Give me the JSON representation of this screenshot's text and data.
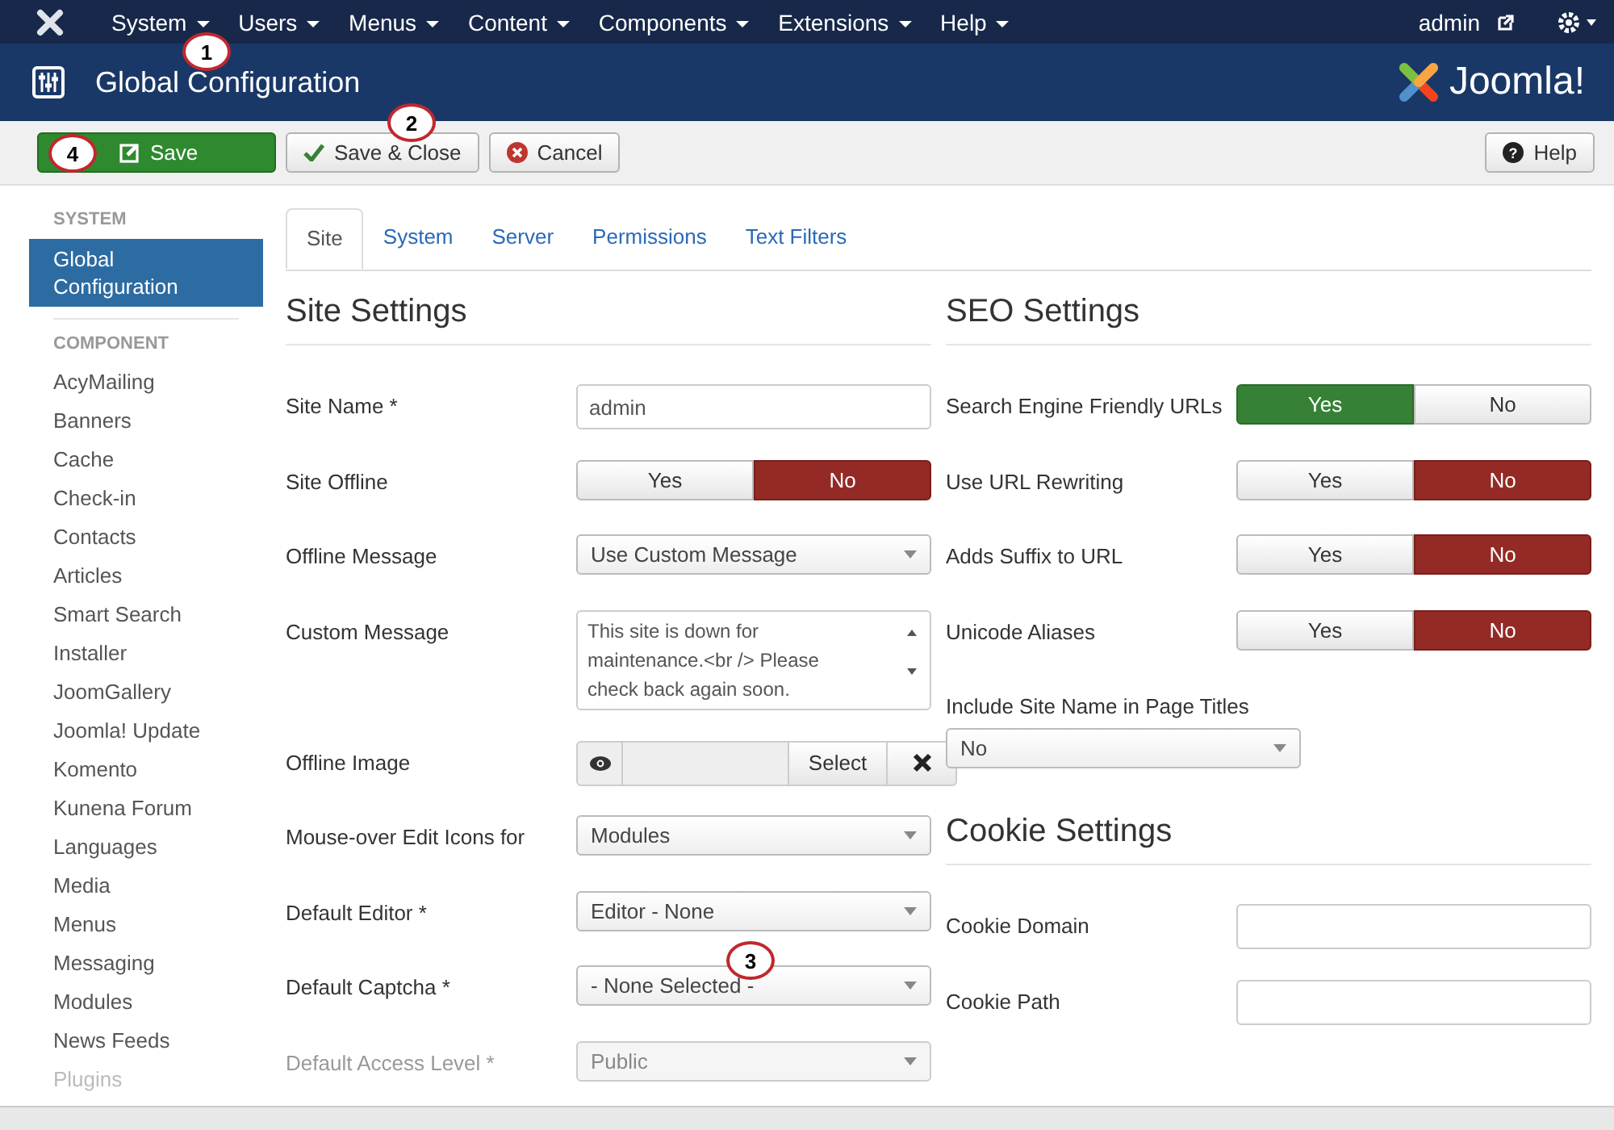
{
  "menu": {
    "items": [
      "System",
      "Users",
      "Menus",
      "Content",
      "Components",
      "Extensions",
      "Help"
    ],
    "user": "admin"
  },
  "header": {
    "title": "Global Configuration",
    "logo": "Joomla!"
  },
  "toolbar": {
    "buttons": [
      {
        "label": "Save",
        "kind": "primary"
      },
      {
        "label": "Save & Close",
        "kind": "check"
      },
      {
        "label": "Cancel",
        "kind": "cancel"
      }
    ],
    "help": "Help",
    "help_icon": "?"
  },
  "sidebar": {
    "sections": [
      {
        "heading": "SYSTEM",
        "items": [
          {
            "label": "Global Configuration",
            "selected": true,
            "disabled": false
          }
        ]
      },
      {
        "heading": "COMPONENT",
        "items": [
          {
            "label": "AcyMailing",
            "selected": false,
            "disabled": false
          },
          {
            "label": "Banners",
            "selected": false,
            "disabled": false
          },
          {
            "label": "Cache",
            "selected": false,
            "disabled": false
          },
          {
            "label": "Check-in",
            "selected": false,
            "disabled": false
          },
          {
            "label": "Contacts",
            "selected": false,
            "disabled": false
          },
          {
            "label": "Articles",
            "selected": false,
            "disabled": false
          },
          {
            "label": "Smart Search",
            "selected": false,
            "disabled": false
          },
          {
            "label": "Installer",
            "selected": false,
            "disabled": false
          },
          {
            "label": "JoomGallery",
            "selected": false,
            "disabled": false
          },
          {
            "label": "Joomla! Update",
            "selected": false,
            "disabled": false
          },
          {
            "label": "Komento",
            "selected": false,
            "disabled": false
          },
          {
            "label": "Kunena Forum",
            "selected": false,
            "disabled": false
          },
          {
            "label": "Languages",
            "selected": false,
            "disabled": false
          },
          {
            "label": "Media",
            "selected": false,
            "disabled": false
          },
          {
            "label": "Menus",
            "selected": false,
            "disabled": false
          },
          {
            "label": "Messaging",
            "selected": false,
            "disabled": false
          },
          {
            "label": "Modules",
            "selected": false,
            "disabled": false
          },
          {
            "label": "News Feeds",
            "selected": false,
            "disabled": false
          },
          {
            "label": "Plugins",
            "selected": false,
            "disabled": true
          }
        ]
      }
    ]
  },
  "tabs": [
    {
      "label": "Site",
      "selected": true
    },
    {
      "label": "System",
      "selected": false
    },
    {
      "label": "Server",
      "selected": false
    },
    {
      "label": "Permissions",
      "selected": false
    },
    {
      "label": "Text Filters",
      "selected": false
    }
  ],
  "site_settings": {
    "title": "Site Settings",
    "fields": [
      {
        "kind": "text",
        "label": "Site Name *",
        "value": "admin"
      },
      {
        "kind": "toggle",
        "label": "Site Offline",
        "yes": "Yes",
        "no": "No",
        "on": false
      },
      {
        "kind": "select",
        "label": "Offline Message",
        "value": "Use Custom Message",
        "disabled": false
      },
      {
        "kind": "textarea",
        "label": "Custom Message",
        "value": "This site is down for maintenance.<br /> Please check back again soon."
      },
      {
        "kind": "media",
        "label": "Offline Image",
        "button": "Select"
      },
      {
        "kind": "select",
        "label": "Mouse-over Edit Icons for",
        "value": "Modules",
        "disabled": false
      },
      {
        "kind": "select",
        "label": "Default Editor *",
        "value": "Editor - None",
        "disabled": false
      },
      {
        "kind": "select",
        "label": "Default Captcha *",
        "value": "- None Selected -",
        "disabled": false
      },
      {
        "kind": "select",
        "label": "Default Access Level *",
        "value": "Public",
        "disabled": true
      }
    ]
  },
  "seo_settings": {
    "title": "SEO Settings",
    "fields": [
      {
        "kind": "toggle",
        "label": "Search Engine Friendly URLs",
        "yes": "Yes",
        "no": "No",
        "on": true
      },
      {
        "kind": "toggle",
        "label": "Use URL Rewriting",
        "yes": "Yes",
        "no": "No",
        "on": false
      },
      {
        "kind": "toggle",
        "label": "Adds Suffix to URL",
        "yes": "Yes",
        "no": "No",
        "on": false
      },
      {
        "kind": "toggle",
        "label": "Unicode Aliases",
        "yes": "Yes",
        "no": "No",
        "on": false
      },
      {
        "kind": "select_below",
        "label": "Include Site Name in Page Titles",
        "value": "No",
        "disabled": false
      }
    ]
  },
  "cookie_settings": {
    "title": "Cookie Settings",
    "fields": [
      {
        "kind": "text",
        "label": "Cookie Domain"
      },
      {
        "kind": "text",
        "label": "Cookie Path"
      }
    ]
  },
  "callouts": [
    "1",
    "2",
    "3",
    "4"
  ]
}
